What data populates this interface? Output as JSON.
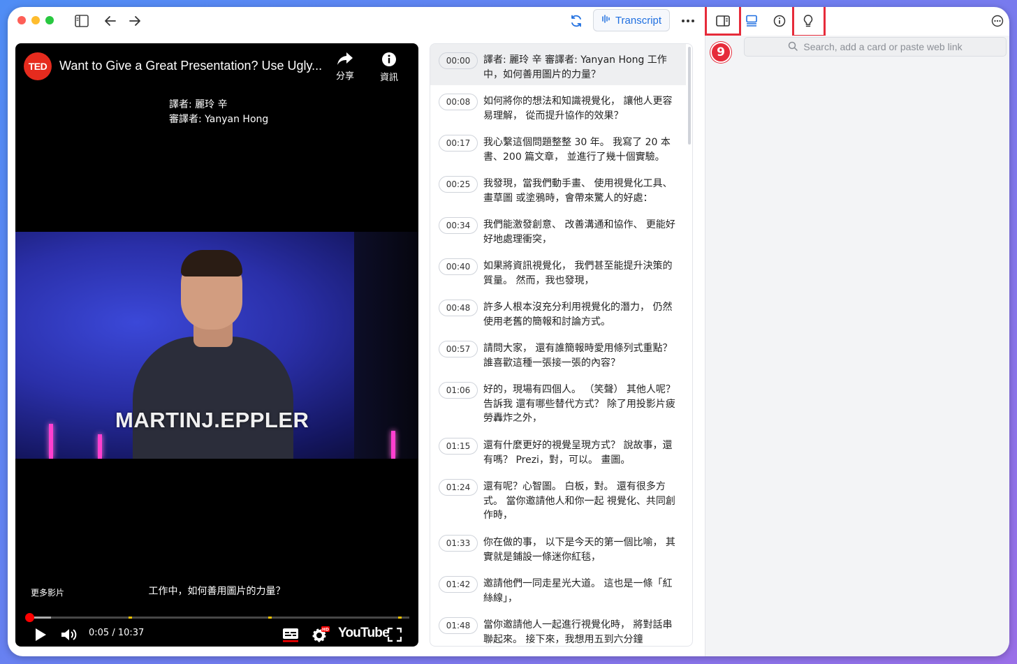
{
  "toolbar": {
    "transcript_label": "Transcript",
    "search_placeholder": "Search, add a card or paste web link",
    "annotation_badge": "9"
  },
  "video": {
    "channel_logo": "TED",
    "title": "Want to Give a Great Presentation? Use Ugly...",
    "share_label": "分享",
    "info_label": "資訊",
    "subtitle_line1": "譯者: 麗玲 辛",
    "subtitle_line2": "審譯者: Yanyan Hong",
    "speaker_name": "MARTINJ.EPPLER",
    "more_videos": "更多影片",
    "caption": "工作中，如何善用圖片的力量？",
    "time_display": "0:05 / 10:37",
    "youtube_label": "YouTube",
    "hd_badge": "HD"
  },
  "transcript": [
    {
      "time": "00:00",
      "text": "譯者: 麗玲 辛 審譯者: Yanyan Hong 工作中，如何善用圖片的力量？"
    },
    {
      "time": "00:08",
      "text": "如何將你的想法和知識視覺化， 讓他人更容易理解， 從而提升協作的效果？"
    },
    {
      "time": "00:17",
      "text": "我心繫這個問題整整 30 年。 我寫了 20 本書、200 篇文章， 並進行了幾十個實驗。"
    },
    {
      "time": "00:25",
      "text": "我發現，當我們動手畫、 使用視覺化工具、畫草圖 或塗鴉時，會帶來驚人的好處："
    },
    {
      "time": "00:34",
      "text": "我們能激發創意、 改善溝通和協作、 更能好好地處理衝突，"
    },
    {
      "time": "00:40",
      "text": "如果將資訊視覺化， 我們甚至能提升決策的質量。 然而，我也發現，"
    },
    {
      "time": "00:48",
      "text": "許多人根本沒充分利用視覺化的潛力， 仍然使用老舊的簡報和討論方式。"
    },
    {
      "time": "00:57",
      "text": "請問大家， 還有誰簡報時愛用條列式重點？ 誰喜歡這種一張接一張的內容？"
    },
    {
      "time": "01:06",
      "text": "好的，現場有四個人。 （笑聲） 其他人呢？ 告訴我 還有哪些替代方式？ 除了用投影片疲勞轟炸之外，"
    },
    {
      "time": "01:15",
      "text": "還有什麼更好的視覺呈現方式？ 說故事，還有嗎？ Prezi，對，可以。 畫圖。"
    },
    {
      "time": "01:24",
      "text": "還有呢？心智圖。 白板，對。 還有很多方式。 當你邀請他人和你一起 視覺化、共同創作時，"
    },
    {
      "time": "01:33",
      "text": "你在做的事， 以下是今天的第一個比喻， 其實就是鋪設一條迷你紅毯，"
    },
    {
      "time": "01:42",
      "text": "邀請他們一同走星光大道。 這也是一條「紅絲線」，"
    },
    {
      "time": "01:48",
      "text": "當你邀請他人一起進行視覺化時， 將對話串聯起來。 接下來，我想用五到六分鐘"
    }
  ],
  "colors": {
    "accent_blue": "#1f6fe0",
    "highlight_red": "#e62b3a",
    "progress_red": "#ff0000",
    "chapter_marker": "#f5c400",
    "ted_red": "#e62b1e"
  },
  "progress": {
    "played_fraction": 0.008
  }
}
